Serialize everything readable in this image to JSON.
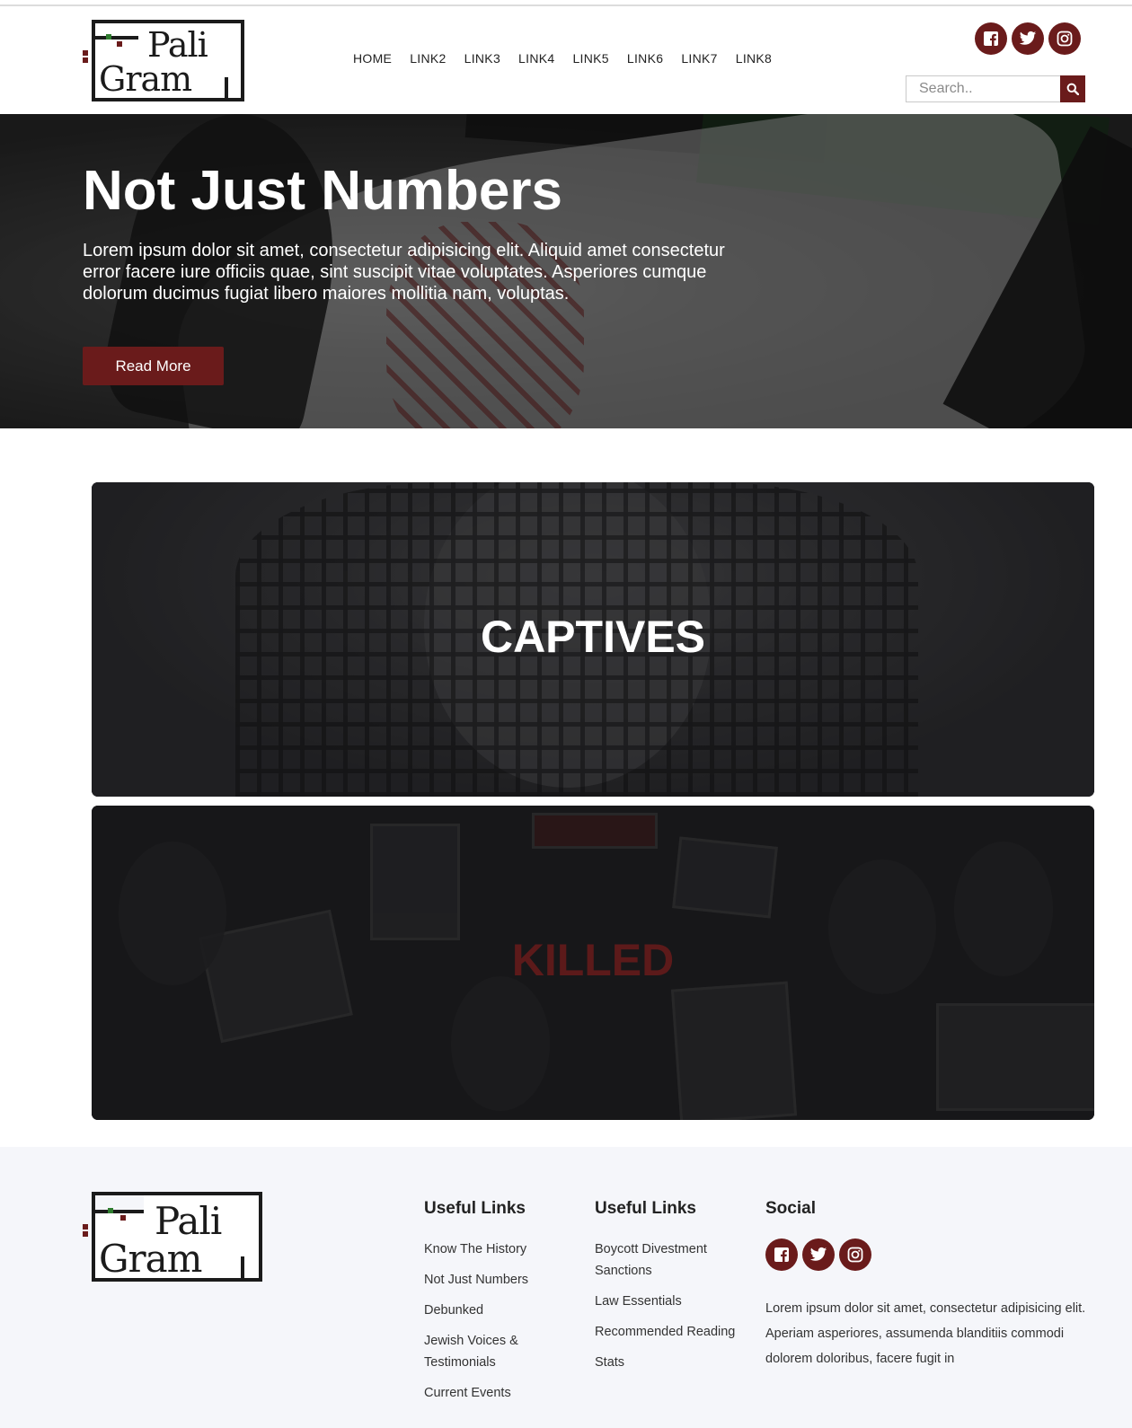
{
  "brand": {
    "logo_line1": "Pali",
    "logo_line2": "Gram"
  },
  "nav": {
    "items": [
      "HOME",
      "LINK2",
      "LINK3",
      "LINK4",
      "LINK5",
      "LINK6",
      "LINK7",
      "LINK8"
    ]
  },
  "search": {
    "placeholder": "Search.."
  },
  "colors": {
    "accent": "#6a1b1b",
    "footer_bg": "#f5f6fa",
    "killed_title": "#5c1a1a"
  },
  "hero": {
    "title": "Not Just Numbers",
    "text": "Lorem ipsum dolor sit amet, consectetur adipisicing elit. Aliquid amet consectetur error facere iure officiis quae, sint suscipit vitae voluptates. Asperiores cumque dolorum ducimus fugiat libero maiores mollitia nam, voluptas.",
    "button": "Read More"
  },
  "cards": [
    {
      "title": "CAPTIVES"
    },
    {
      "title": "KILLED"
    }
  ],
  "footer": {
    "col1": {
      "heading": "Useful Links",
      "links": [
        "Know The History",
        "Not Just Numbers",
        "Debunked",
        "Jewish Voices & Testimonials",
        "Current Events"
      ]
    },
    "col2": {
      "heading": "Useful Links",
      "links": [
        "Boycott Divestment Sanctions",
        "Law Essentials",
        "Recommended Reading",
        "Stats"
      ]
    },
    "social": {
      "heading": "Social",
      "text": "Lorem ipsum dolor sit amet, consectetur adipisicing elit. Aperiam asperiores, assumenda blanditiis commodi dolorem doloribus, facere fugit in"
    }
  },
  "icons": {
    "social": [
      "facebook-icon",
      "twitter-icon",
      "instagram-icon"
    ],
    "search": "search-icon"
  }
}
